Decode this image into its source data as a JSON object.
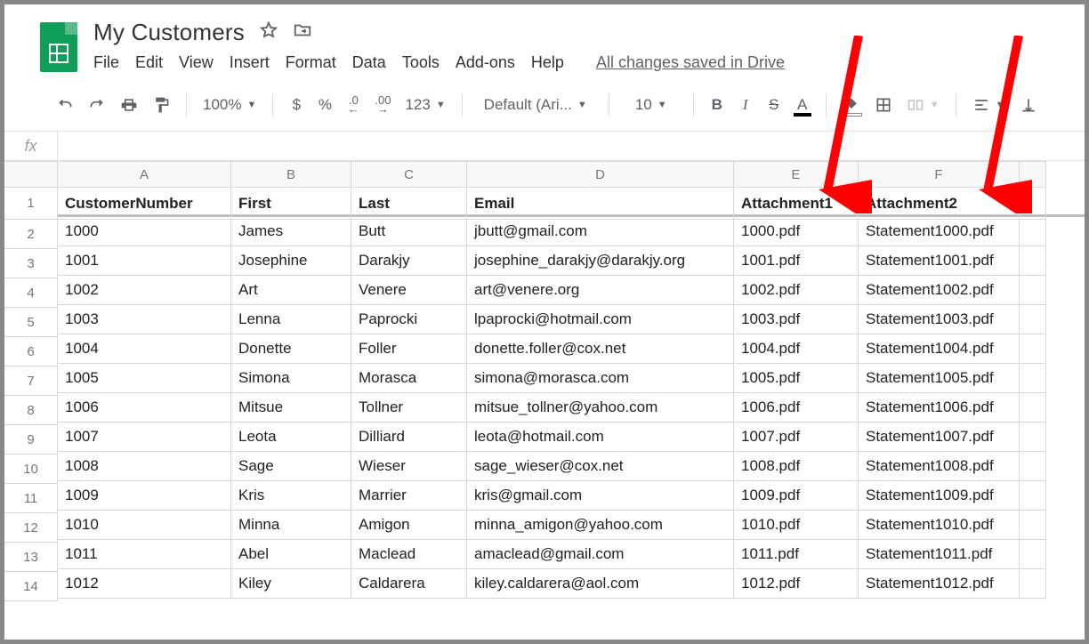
{
  "doc_title": "My Customers",
  "menubar": [
    "File",
    "Edit",
    "View",
    "Insert",
    "Format",
    "Data",
    "Tools",
    "Add-ons",
    "Help"
  ],
  "save_status": "All changes saved in Drive",
  "toolbar": {
    "zoom": "100%",
    "currency": "$",
    "percent": "%",
    "dec_dec": ".0",
    "inc_dec": ".00",
    "num_format": "123",
    "font": "Default (Ari...",
    "font_size": "10"
  },
  "formula_bar": {
    "fx_label": "fx",
    "value": ""
  },
  "columns": [
    "A",
    "B",
    "C",
    "D",
    "E",
    "F",
    ""
  ],
  "headers": [
    "CustomerNumber",
    "First",
    "Last",
    "Email",
    "Attachment1",
    "Attachment2"
  ],
  "rows": [
    {
      "n": "1000",
      "first": "James",
      "last": "Butt",
      "email": "jbutt@gmail.com",
      "a1": "1000.pdf",
      "a2": "Statement1000.pdf"
    },
    {
      "n": "1001",
      "first": "Josephine",
      "last": "Darakjy",
      "email": "josephine_darakjy@darakjy.org",
      "a1": "1001.pdf",
      "a2": "Statement1001.pdf"
    },
    {
      "n": "1002",
      "first": "Art",
      "last": "Venere",
      "email": "art@venere.org",
      "a1": "1002.pdf",
      "a2": "Statement1002.pdf"
    },
    {
      "n": "1003",
      "first": "Lenna",
      "last": "Paprocki",
      "email": "lpaprocki@hotmail.com",
      "a1": "1003.pdf",
      "a2": "Statement1003.pdf"
    },
    {
      "n": "1004",
      "first": "Donette",
      "last": "Foller",
      "email": "donette.foller@cox.net",
      "a1": "1004.pdf",
      "a2": "Statement1004.pdf"
    },
    {
      "n": "1005",
      "first": "Simona",
      "last": "Morasca",
      "email": "simona@morasca.com",
      "a1": "1005.pdf",
      "a2": "Statement1005.pdf"
    },
    {
      "n": "1006",
      "first": "Mitsue",
      "last": "Tollner",
      "email": "mitsue_tollner@yahoo.com",
      "a1": "1006.pdf",
      "a2": "Statement1006.pdf"
    },
    {
      "n": "1007",
      "first": "Leota",
      "last": "Dilliard",
      "email": "leota@hotmail.com",
      "a1": "1007.pdf",
      "a2": "Statement1007.pdf"
    },
    {
      "n": "1008",
      "first": "Sage",
      "last": "Wieser",
      "email": "sage_wieser@cox.net",
      "a1": "1008.pdf",
      "a2": "Statement1008.pdf"
    },
    {
      "n": "1009",
      "first": "Kris",
      "last": "Marrier",
      "email": "kris@gmail.com",
      "a1": "1009.pdf",
      "a2": "Statement1009.pdf"
    },
    {
      "n": "1010",
      "first": "Minna",
      "last": "Amigon",
      "email": "minna_amigon@yahoo.com",
      "a1": "1010.pdf",
      "a2": "Statement1010.pdf"
    },
    {
      "n": "1011",
      "first": "Abel",
      "last": "Maclead",
      "email": "amaclead@gmail.com",
      "a1": "1011.pdf",
      "a2": "Statement1011.pdf"
    },
    {
      "n": "1012",
      "first": "Kiley",
      "last": "Caldarera",
      "email": "kiley.caldarera@aol.com",
      "a1": "1012.pdf",
      "a2": "Statement1012.pdf"
    }
  ],
  "row_labels": [
    "1",
    "2",
    "3",
    "4",
    "5",
    "6",
    "7",
    "8",
    "9",
    "10",
    "11",
    "12",
    "13",
    "14"
  ]
}
